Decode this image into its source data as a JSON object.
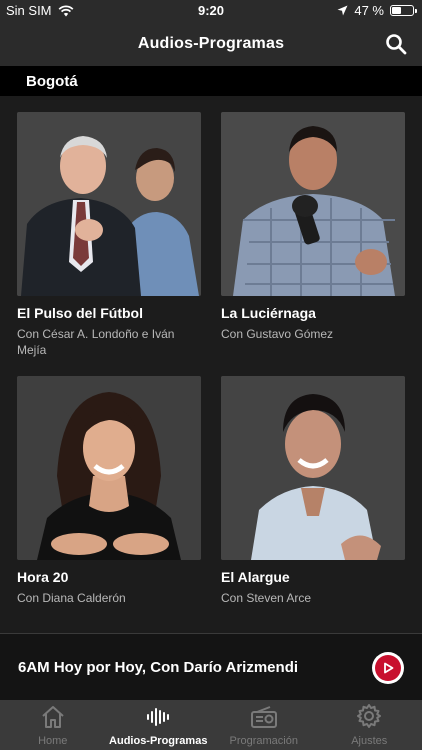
{
  "status": {
    "carrier": "Sin SIM",
    "time": "9:20",
    "battery": "47 %",
    "battery_level": 0.47
  },
  "header": {
    "title": "Audios-Programas"
  },
  "city": "Bogotá",
  "programs": [
    {
      "title": "El Pulso del Fútbol",
      "subtitle": "Con César A. Londoño e Iván Mejía"
    },
    {
      "title": "La Luciérnaga",
      "subtitle": "Con Gustavo Gómez"
    },
    {
      "title": "Hora 20",
      "subtitle": "Con Diana Calderón"
    },
    {
      "title": "El Alargue",
      "subtitle": "Con Steven Arce"
    }
  ],
  "player": {
    "now_playing": "6AM Hoy por Hoy, Con Darío Arizmendi"
  },
  "tabs": [
    {
      "label": "Home",
      "icon": "home-icon"
    },
    {
      "label": "Audios-Programas",
      "icon": "audio-wave-icon"
    },
    {
      "label": "Programación",
      "icon": "radio-icon"
    },
    {
      "label": "Ajustes",
      "icon": "gear-icon"
    }
  ],
  "colors": {
    "accent": "#c8102e",
    "bar": "#2b2b2b",
    "background": "#1c1c1c"
  }
}
